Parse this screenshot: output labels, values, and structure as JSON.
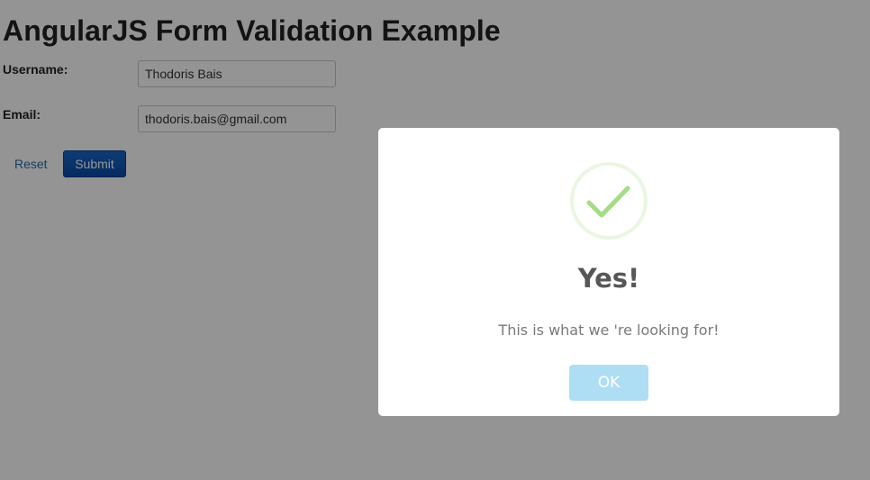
{
  "page": {
    "title": "AngularJS Form Validation Example"
  },
  "form": {
    "username_label": "Username:",
    "username_value": "Thodoris Bais",
    "email_label": "Email:",
    "email_value": "thodoris.bais@gmail.com",
    "reset_label": "Reset",
    "submit_label": "Submit"
  },
  "dialog": {
    "icon": "success-checkmark-icon",
    "title": "Yes!",
    "message": "This is what we 're looking for!",
    "ok_label": "OK"
  },
  "colors": {
    "dialog_success": "#a5dc86",
    "ok_button": "#aedef4",
    "submit_button": "#0a4aa6",
    "link": "#2a6aa8"
  }
}
